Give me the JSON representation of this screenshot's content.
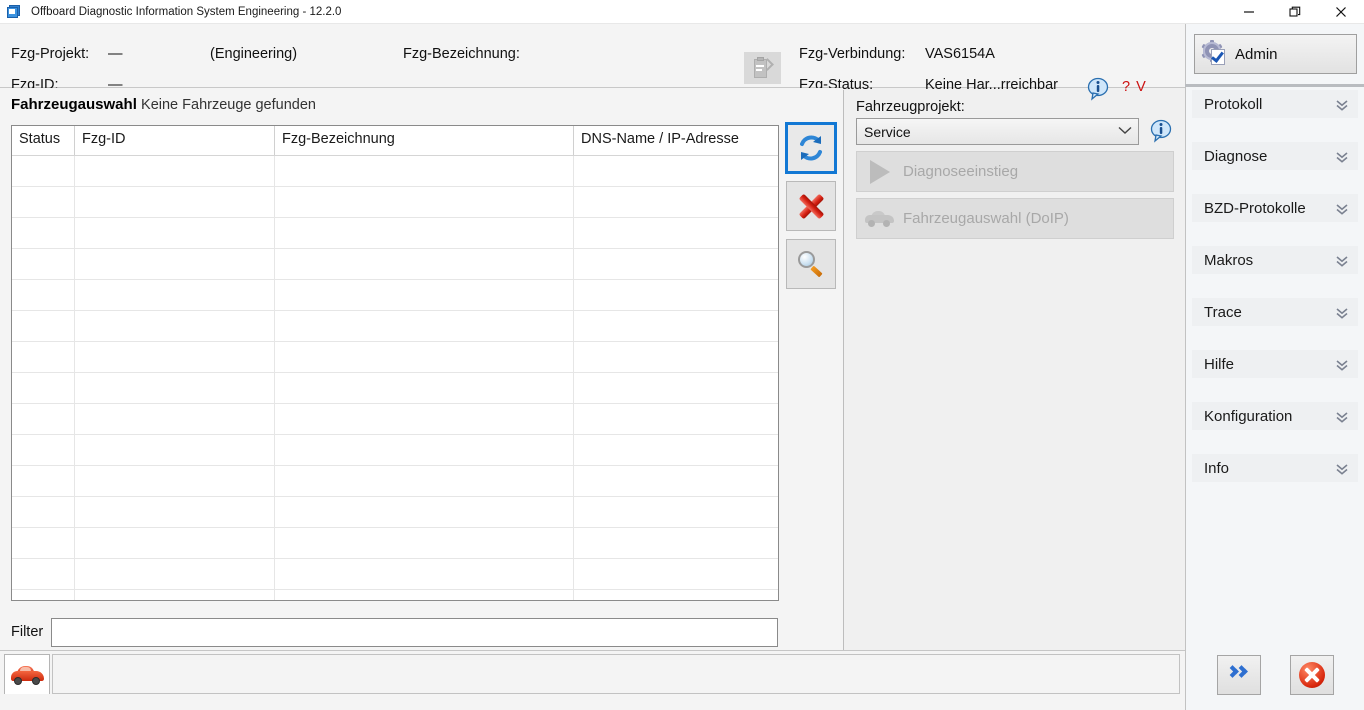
{
  "window": {
    "title": "Offboard Diagnostic Information System Engineering - 12.2.0",
    "app_icon": "app-window-icon",
    "minimize": "—",
    "maximize": "❐",
    "close": "✕"
  },
  "header": {
    "project_label": "Fzg-Projekt:",
    "project_value": "—",
    "engineering_tag": "(Engineering)",
    "designation_label": "Fzg-Bezeichnung:",
    "designation_value": "",
    "id_label": "Fzg-ID:",
    "id_value": "—",
    "connection_label": "Fzg-Verbindung:",
    "connection_value": "VAS6154A",
    "status_label": "Fzg-Status:",
    "status_value": "Keine Har...rreichbar",
    "info_icon": "info-icon",
    "question_mark": "? V",
    "clipboard_icon": "clipboard-edit-icon"
  },
  "vehicle_selection": {
    "title": "Fahrzeugauswahl",
    "subtitle": "Keine Fahrzeuge gefunden",
    "columns": [
      "Status",
      "Fzg-ID",
      "Fzg-Bezeichnung",
      "DNS-Name / IP-Adresse"
    ],
    "rows": [],
    "row_count": 15,
    "actions": {
      "refresh": "refresh-icon",
      "delete": "delete-x-icon",
      "search": "magnifier-icon"
    }
  },
  "filter": {
    "label": "Filter",
    "value": "",
    "placeholder": ""
  },
  "project_panel": {
    "label": "Fahrzeugprojekt:",
    "selected": "Service",
    "options": [
      "Service"
    ],
    "chevron": "⌄",
    "info_icon": "info-icon",
    "diagnose_button": "Diagnoseeinstieg",
    "doip_button": "Fahrzeugauswahl (DoIP)"
  },
  "statusbar": {
    "tab_icon": "red-car-icon",
    "text": "",
    "icons": [
      "grey-x-icon",
      "grey-car-icon",
      "window-check-icon",
      "grid-icon"
    ]
  },
  "sidebar": {
    "admin_label": "Admin",
    "admin_icon": "gear-check-icon",
    "items": [
      {
        "label": "Protokoll"
      },
      {
        "label": "Diagnose"
      },
      {
        "label": "BZD-Protokolle"
      },
      {
        "label": "Makros"
      },
      {
        "label": "Trace"
      },
      {
        "label": "Hilfe"
      },
      {
        "label": "Konfiguration"
      },
      {
        "label": "Info"
      }
    ],
    "next_icon": "double-chevron-right-icon",
    "close_icon": "close-circle-icon"
  },
  "colors": {
    "accent_blue": "#1278d4",
    "error_red": "#cc1111",
    "window_bg": "#f4f4f4"
  }
}
